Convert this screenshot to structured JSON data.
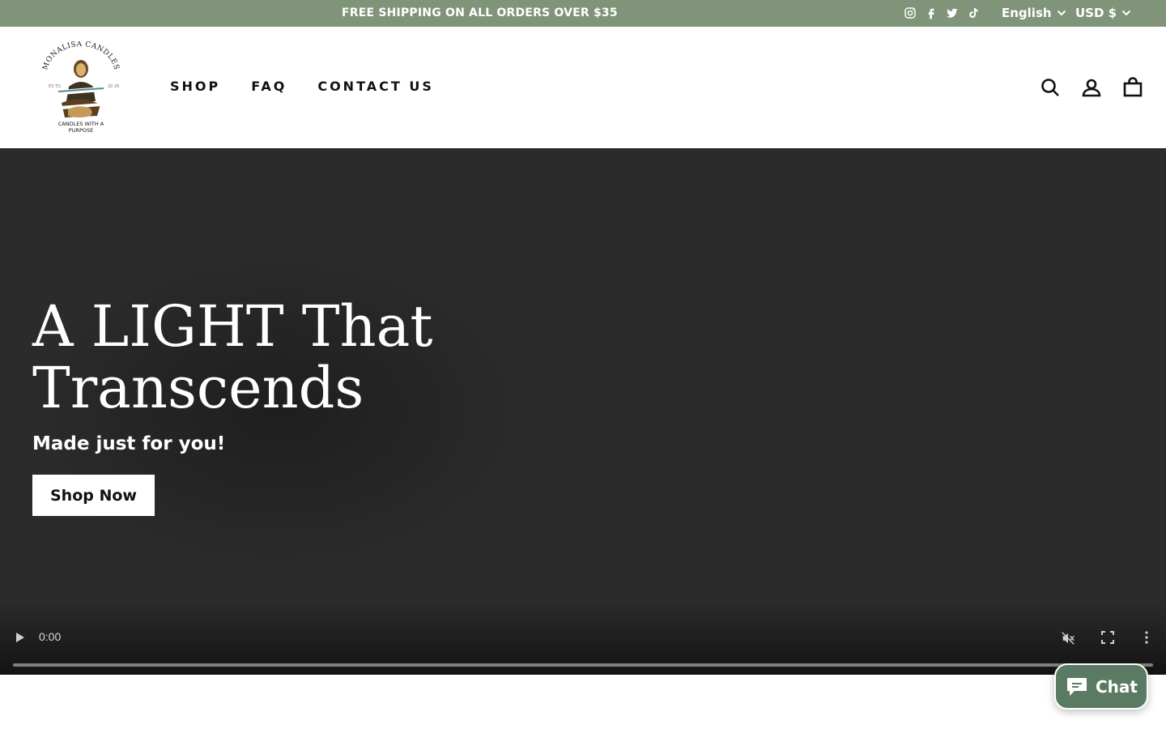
{
  "announcement": {
    "text": "FREE SHIPPING ON ALL ORDERS OVER $35"
  },
  "social_icons": [
    "instagram-icon",
    "facebook-icon",
    "twitter-icon",
    "tiktok-icon"
  ],
  "language": {
    "selected": "English"
  },
  "currency": {
    "selected": "USD $"
  },
  "logo": {
    "arc_text": "MONALISA CANDLES",
    "est_left": "ES TD",
    "est_right": "20 20",
    "tagline_line1": "CANDLES WITH A",
    "tagline_line2": "PURPOSE"
  },
  "nav": {
    "items": [
      {
        "label": "SHOP"
      },
      {
        "label": "FAQ"
      },
      {
        "label": "CONTACT US"
      }
    ]
  },
  "header_icons": [
    "search-icon",
    "account-icon",
    "cart-icon"
  ],
  "hero": {
    "title_line1": "A LIGHT That",
    "title_line2": "Transcends",
    "subtitle": "Made just for you!",
    "button_label": "Shop Now"
  },
  "video": {
    "time": "0:00",
    "progress": 0
  },
  "chat": {
    "label": "Chat"
  },
  "colors": {
    "topbar_bg": "#7f9478",
    "hero_bg": "#2b2b2b",
    "chat_bg": "#5b7a63",
    "text_dark": "#111111"
  }
}
